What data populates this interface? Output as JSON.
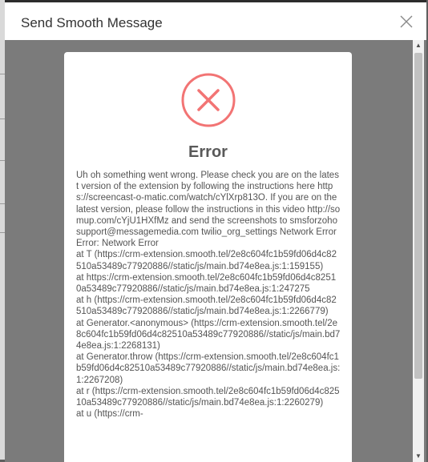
{
  "modal": {
    "title": "Send Smooth Message",
    "close_icon": "close-icon"
  },
  "error_dialog": {
    "icon": "error-x-icon",
    "title": "Error",
    "message": "Uh oh something went wrong. Please check you are on the latest version of the extension by following the instructions here https://screencast-o-matic.com/watch/cYlXrp813O. If you are on the latest version, please follow the instructions in this video http://somup.com/cYjU1HXfMz and send the screenshots to smsforzohosupport@messagemedia.com twilio_org_settings Network Error Error: Network Error\nat T (https://crm-extension.smooth.tel/2e8c604fc1b59fd06d4c82510a53489c77920886//static/js/main.bd74e8ea.js:1:159155)\nat https://crm-extension.smooth.tel/2e8c604fc1b59fd06d4c82510a53489c77920886//static/js/main.bd74e8ea.js:1:247275\nat h (https://crm-extension.smooth.tel/2e8c604fc1b59fd06d4c82510a53489c77920886//static/js/main.bd74e8ea.js:1:2266779)\nat Generator.<anonymous> (https://crm-extension.smooth.tel/2e8c604fc1b59fd06d4c82510a53489c77920886//static/js/main.bd74e8ea.js:1:2268131)\nat Generator.throw (https://crm-extension.smooth.tel/2e8c604fc1b59fd06d4c82510a53489c77920886//static/js/main.bd74e8ea.js:1:2267208)\nat r (https://crm-extension.smooth.tel/2e8c604fc1b59fd06d4c82510a53489c77920886//static/js/main.bd74e8ea.js:1:2260279)\nat u (https://crm-"
  },
  "colors": {
    "error_accent": "#f27474",
    "overlay": "#7b7b7b"
  }
}
